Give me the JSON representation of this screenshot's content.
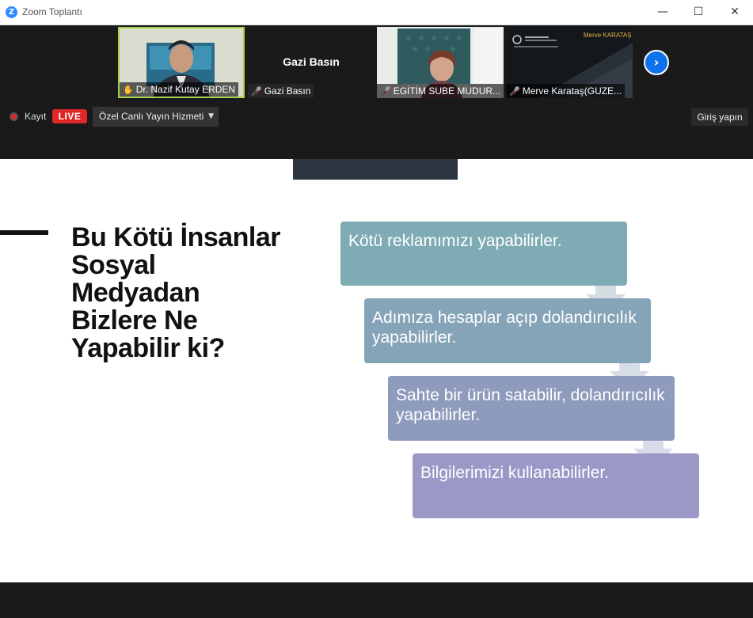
{
  "window": {
    "title": "Zoom Toplantı",
    "logo": "Z",
    "minimize": "—",
    "maximize": "☐",
    "close": "✕"
  },
  "participants": [
    {
      "name": "Dr. Nazif Kutay ERDEN",
      "center_name": "",
      "muted": false,
      "active": true
    },
    {
      "name": "Gazi Basın",
      "center_name": "Gazi Basın",
      "muted": true,
      "active": false
    },
    {
      "name": "EGİTİM SUBE MUDUR...",
      "center_name": "",
      "muted": true,
      "active": false
    },
    {
      "name": "Merve Karataş(GUZE...",
      "center_name": "",
      "muted": true,
      "active": false
    }
  ],
  "tile_texts": {
    "merve_overlay": "Merve KARATAŞ"
  },
  "next_button": "›",
  "toolbar": {
    "record_label": "Kayıt",
    "live_label": "LIVE",
    "stream_service": "Özel Canlı Yayın Hizmeti",
    "signin_label": "Giriş yapın"
  },
  "slide": {
    "title_lines": [
      "Bu Kötü İnsanlar",
      "Sosyal",
      "Medyadan",
      "Bizlere Ne",
      "Yapabilir ki?"
    ],
    "steps": [
      {
        "text": "Kötü reklamımızı yapabilirler.",
        "color": "#7fabb5"
      },
      {
        "text": "Adımıza hesaplar açıp dolandırıcılık yapabilirler.",
        "color": "#86a4b8"
      },
      {
        "text": "Sahte bir ürün satabilir, dolandırıcılık yapabilirler.",
        "color": "#8e9bbc"
      },
      {
        "text": "Bilgilerimizi kullanabilirler.",
        "color": "#9b98c8"
      }
    ]
  },
  "colors": {
    "accent_blue": "#0e72ed",
    "live_red": "#e02828",
    "active_border": "#a8d04a"
  }
}
